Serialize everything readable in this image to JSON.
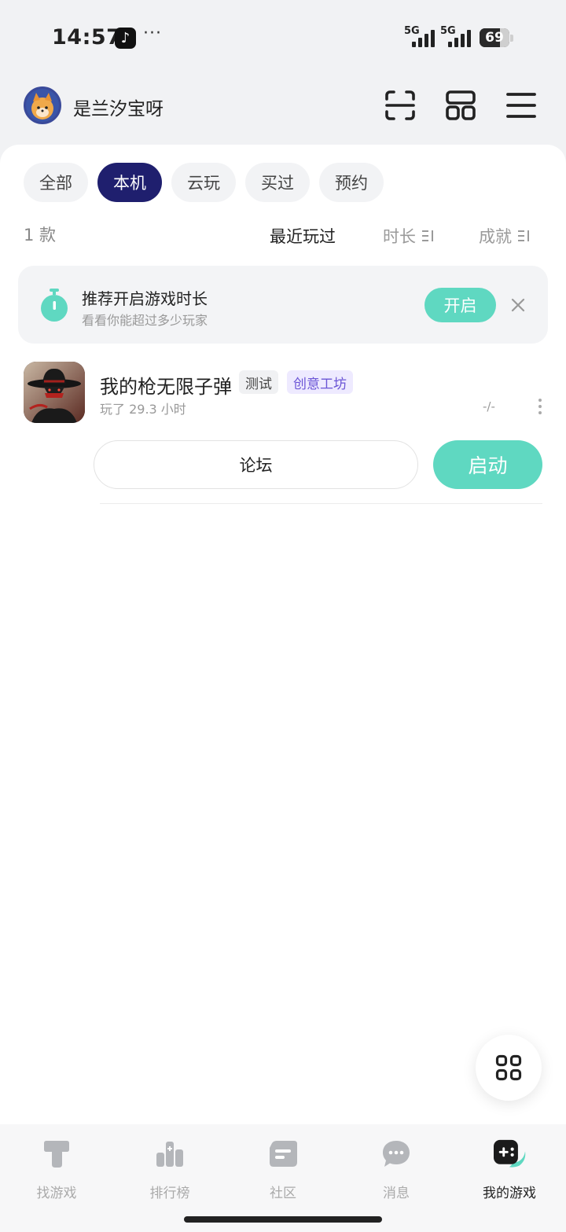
{
  "status": {
    "time": "14:57",
    "tiktok_glyph": "♪",
    "dots": "···",
    "network_1": "5G",
    "network_2": "5G",
    "battery": "69",
    "battery_level": 0.69
  },
  "header": {
    "username": "是兰汐宝呀",
    "icons": [
      "scan-icon",
      "widgets-icon",
      "menu-icon"
    ]
  },
  "filters": {
    "chips": [
      {
        "label": "全部",
        "active": false
      },
      {
        "label": "本机",
        "active": true
      },
      {
        "label": "云玩",
        "active": false
      },
      {
        "label": "买过",
        "active": false
      },
      {
        "label": "预约",
        "active": false
      }
    ]
  },
  "list_meta": {
    "count": "1 款",
    "sort": {
      "recent": "最近玩过",
      "duration": "时长",
      "achievement": "成就"
    }
  },
  "banner": {
    "title": "推荐开启游戏时长",
    "subtitle": "看看你能超过多少玩家",
    "button": "开启"
  },
  "game": {
    "title": "我的枪无限子弹",
    "tag_test": "测试",
    "tag_workshop": "创意工坊",
    "playtime": "玩了 29.3 小时",
    "achievement": "-/-",
    "forum_button": "论坛",
    "launch_button": "启动"
  },
  "bottom_nav": {
    "items": [
      {
        "label": "找游戏",
        "icon": "find-games-icon",
        "active": false
      },
      {
        "label": "排行榜",
        "icon": "leaderboard-icon",
        "active": false
      },
      {
        "label": "社区",
        "icon": "community-icon",
        "active": false
      },
      {
        "label": "消息",
        "icon": "message-icon",
        "active": false
      },
      {
        "label": "我的游戏",
        "icon": "my-games-icon",
        "active": true
      }
    ]
  },
  "colors": {
    "accent": "#5fd8c1",
    "chip_active": "#1f1f6e",
    "workshop_tag": "#6b55d6"
  }
}
